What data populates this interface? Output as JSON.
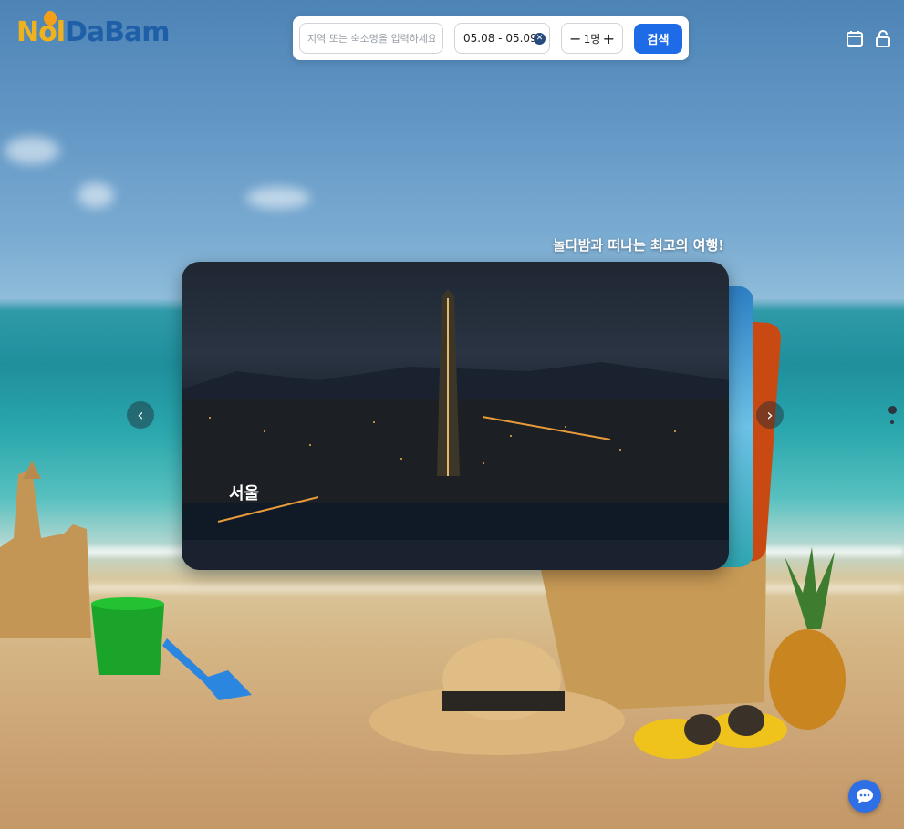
{
  "logo": {
    "part1": "Nol",
    "part2": "DaBam"
  },
  "search": {
    "placeholder": "지역 또는 숙소명을 입력하세요",
    "dates": "05.08 - 05.09",
    "guests": "1명",
    "minus": "−",
    "plus": "+",
    "button_label": "검색"
  },
  "header_icons": [
    "calendar-icon",
    "unlock-icon"
  ],
  "hero": {
    "tagline": "놀다밤과 떠나는 최고의 여행!",
    "slide_caption": "서울",
    "prev_arrow": "‹",
    "next_arrow": "›"
  },
  "colors": {
    "accent": "#1e6be8",
    "logo_yellow": "#f0b21c",
    "logo_blue": "#1f5fa8"
  }
}
